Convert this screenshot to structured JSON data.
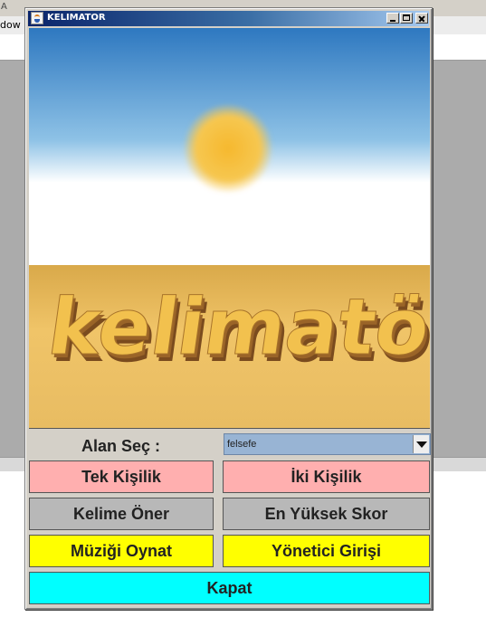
{
  "background_app": {
    "title_fragment": "A",
    "menu_fragment": "dow"
  },
  "window": {
    "title": "KELIMATOR",
    "title_icon": "java-cup-icon",
    "controls": [
      "minimize-icon",
      "maximize-icon",
      "close-icon"
    ]
  },
  "logo": {
    "text": "kelimatör",
    "colors": {
      "sky_top": "#2e78c0",
      "sky_bottom": "#ffffff",
      "sun": "#f5bd3a",
      "desert": "#e8b85a",
      "letters_face": "#f2c14e",
      "letters_side": "#7a4b1e"
    }
  },
  "controls": {
    "category_label": "Alan Seç :",
    "category_selected": "felsefe",
    "buttons": {
      "single_player": "Tek Kişilik",
      "two_player": "İki Kişilik",
      "suggest_word": "Kelime Öner",
      "high_score": "En Yüksek Skor",
      "play_music": "Müziği Oynat",
      "admin_login": "Yönetici Girişi",
      "close": "Kapat"
    },
    "colors": {
      "pink": "#ffafaf",
      "gray": "#b8b8b8",
      "yellow": "#ffff00",
      "cyan": "#00ffff",
      "combo_bg": "#98b4d4"
    }
  }
}
